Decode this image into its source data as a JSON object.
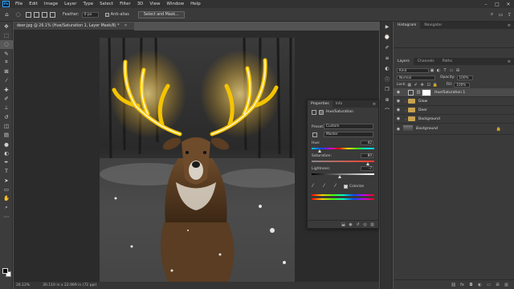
{
  "app": {
    "logo": "Ps"
  },
  "menubar": {
    "items": [
      "File",
      "Edit",
      "Image",
      "Layer",
      "Type",
      "Select",
      "Filter",
      "3D",
      "View",
      "Window",
      "Help"
    ],
    "window_controls": [
      "–",
      "□",
      "✕"
    ]
  },
  "options_bar": {
    "feather_label": "Feather:",
    "feather_value": "0 px",
    "anti_alias_label": "Anti-alias",
    "select_mask_label": "Select and Mask..."
  },
  "document": {
    "tab_title": "deer.jpg @ 26.1% (Hue/Saturation 1, Layer Mask/8) *",
    "zoom": "26.12%",
    "doc_size": "30.110 in x 22.969 in (72 ppi)"
  },
  "properties": {
    "tabs": [
      "Properties",
      "Info"
    ],
    "header": "Hue/Saturation",
    "preset_label": "Preset:",
    "preset_value": "Custom",
    "channel_value": "Master",
    "hue_label": "Hue:",
    "hue_value": "42",
    "saturation_label": "Saturation:",
    "saturation_value": "80",
    "lightness_label": "Lightness:",
    "lightness_value": "-7",
    "colorize_label": "Colorize"
  },
  "right_panel": {
    "top_tabs": [
      "Histogram",
      "Navigator"
    ],
    "tabs": [
      "Layers",
      "Channels",
      "Paths"
    ],
    "kind_label": "Kind",
    "blend_mode": "Normal",
    "opacity_label": "Opacity:",
    "opacity_value": "100%",
    "lock_label": "Lock:",
    "fill_label": "Fill:",
    "fill_value": "100%",
    "layers": [
      {
        "name": "Hue/Saturation 1"
      },
      {
        "name": "Glow"
      },
      {
        "name": "Deer"
      },
      {
        "name": "Background"
      },
      {
        "name": "Background"
      }
    ]
  },
  "colors": {
    "accent": "#31a8ff",
    "antler_glow": "#f5c400"
  }
}
